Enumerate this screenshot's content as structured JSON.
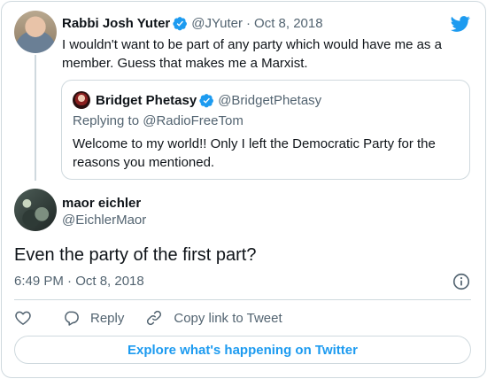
{
  "parent_tweet": {
    "name": "Rabbi Josh Yuter",
    "handle": "@JYuter",
    "separator": "·",
    "date": "Oct 8, 2018",
    "text": "I wouldn't want to be part of any party which would have me as a member. Guess that makes me a Marxist."
  },
  "quoted_tweet": {
    "name": "Bridget Phetasy",
    "handle": "@BridgetPhetasy",
    "replying_to": "Replying to @RadioFreeTom",
    "text": "Welcome to my world!! Only I left the Democratic Party for the reasons you mentioned."
  },
  "main_tweet": {
    "name": "maor eichler",
    "handle": "@EichlerMaor",
    "text": "Even the party of the first part?",
    "timestamp": "6:49 PM · Oct 8, 2018"
  },
  "actions": {
    "like_icon": "heart-icon",
    "reply_label": "Reply",
    "copy_link_label": "Copy link to Tweet"
  },
  "explore_label": "Explore what's happening on Twitter",
  "icons": {
    "brand": "twitter-bird-icon",
    "verified": "verified-badge-icon",
    "info": "info-icon"
  },
  "colors": {
    "twitter_blue": "#1d9bf0",
    "secondary_text": "#536471",
    "border": "#cfd9de"
  }
}
